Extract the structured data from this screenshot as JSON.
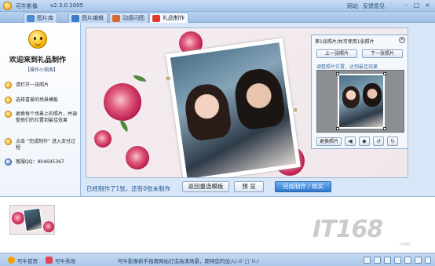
{
  "app": {
    "title": "可牛影像",
    "version": "v2.3.0.1005",
    "links": [
      "网站",
      "反馈意见"
    ]
  },
  "window_buttons": [
    "-",
    "□",
    "×"
  ],
  "tabs": [
    {
      "label": "图片库",
      "icon": "gallery-icon"
    },
    {
      "label": "图片编辑",
      "icon": "edit-icon"
    },
    {
      "label": "动感闪图",
      "icon": "flash-icon"
    },
    {
      "label": "礼品制作",
      "icon": "gift-icon",
      "active": true
    }
  ],
  "sidebar": {
    "welcome": "欢迎来到礼品制作",
    "guide_title": "【操作小指南】",
    "steps": [
      "请打开一张照片",
      "选择喜爱的场景模板",
      "更换每个场景上的照片，并调整他们的位置到最佳效果",
      "点击 “完成制作” 进入支付过程",
      "客服QQ：904695367"
    ]
  },
  "panel": {
    "title": "第1张照片/共可使用1张照片",
    "prev_label": "上一张照片",
    "next_label": "下一张照片",
    "hint": "调整照片位置，达到最佳效果",
    "replace_label": "更换照片",
    "icon_buttons": [
      "flip-horizontal-icon",
      "flip-vertical-icon",
      "rotate-left-icon",
      "rotate-right-icon"
    ]
  },
  "main": {
    "status": "已经制作了1张，还有0张未制作",
    "back_label": "返回重选模板",
    "preview_label": "预 览",
    "finish_label": "完成制作 / 购买"
  },
  "watermark": {
    "text": "IT168",
    "sub": ".com"
  },
  "statusbar": {
    "home_label": "可牛首页",
    "forum_label": "可牛秀场",
    "message": "可牛影像新手指南网站打造高清场景，期待您的加入(.0`□`0.)"
  },
  "colors": {
    "accent": "#2f78cf",
    "frame": "#d8e7f7",
    "status_text": "#1d4f9a"
  }
}
